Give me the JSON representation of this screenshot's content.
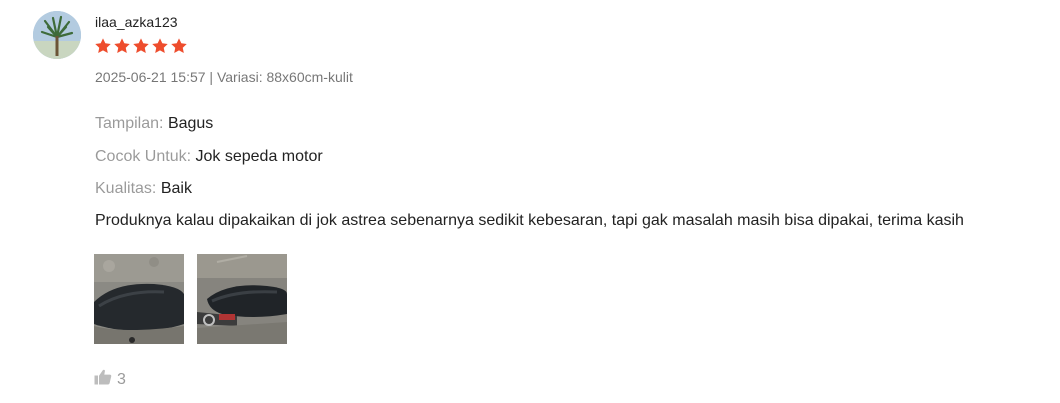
{
  "review": {
    "username": "ilaa_azka123",
    "rating": 5,
    "star_color": "#ee4d2d",
    "meta": "2025-06-21 15:57 | Variasi: 88x60cm-kulit",
    "attributes": [
      {
        "label": "Tampilan:",
        "value": "Bagus"
      },
      {
        "label": "Cocok Untuk:",
        "value": "Jok sepeda motor"
      },
      {
        "label": "Kualitas:",
        "value": "Baik"
      }
    ],
    "comment": "Produknya kalau dipakaikan di jok astrea sebenarnya sedikit kebesaran, tapi gak masalah masih bisa dipakai, terima kasih",
    "photos": [
      {
        "icon": "motorcycle-seat-photo-1"
      },
      {
        "icon": "motorcycle-seat-photo-2"
      }
    ],
    "likes": "3",
    "like_icon": "thumbs-up-icon"
  }
}
